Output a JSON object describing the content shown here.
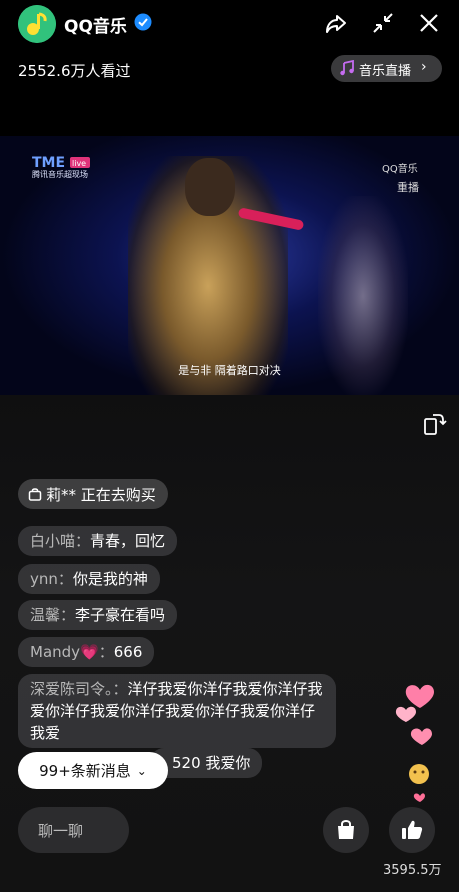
{
  "header": {
    "app_name": "QQ音乐",
    "viewers": "2552.6万人看过",
    "live_pill": "音乐直播"
  },
  "video": {
    "brand_line": "腾讯音乐超现场",
    "brand_tag": "live",
    "watermark": "QQ音乐",
    "replay_label": "重播",
    "subtitle": "是与非 隔着路口对决"
  },
  "chat": {
    "purchase_notice": "莉** 正在去购买",
    "messages": [
      {
        "user": "白小喵",
        "text": "青春，回忆"
      },
      {
        "user": "ynn",
        "text": "你是我的神"
      },
      {
        "user": "温馨",
        "text": "李子豪在看吗"
      },
      {
        "user": "Mandy💗",
        "text": "666"
      },
      {
        "user": "深爱陈司令。",
        "text": "洋仔我爱你洋仔我爱你洋仔我爱你洋仔我爱你洋仔我爱你洋仔我爱你洋仔我爱"
      },
      {
        "user": "",
        "text": "520 我爱你"
      }
    ],
    "new_messages_button": "99+条新消息",
    "input_placeholder": "聊一聊"
  },
  "footer": {
    "like_count": "3595.5万"
  },
  "colors": {
    "brand_green": "#31c27c",
    "pill_bg": "#3a3a3c",
    "button_bg": "#2c2c2e",
    "mic_pink": "#d8205a"
  },
  "icons": [
    "qq-music-logo-icon",
    "verified-icon",
    "share-icon",
    "minimize-icon",
    "close-icon",
    "music-note-icon",
    "chevron-right-icon",
    "rotate-screen-icon",
    "shopping-bag-icon",
    "thumbs-up-icon",
    "chevron-down-icon"
  ]
}
